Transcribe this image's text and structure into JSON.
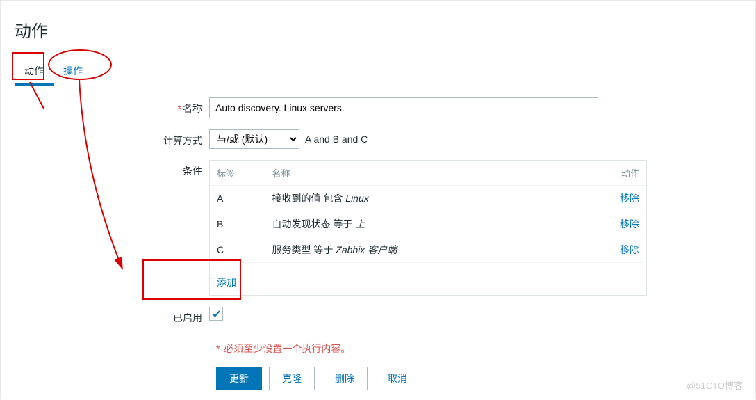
{
  "page": {
    "title": "动作"
  },
  "tabs": [
    {
      "id": "action",
      "label": "动作",
      "active": true
    },
    {
      "id": "operation",
      "label": "操作",
      "active": false
    }
  ],
  "fields": {
    "name_label": "名称",
    "name_value": "Auto discovery. Linux servers.",
    "calc_label": "计算方式",
    "calc_option": "与/或 (默认)",
    "calc_expr": "A and B and C",
    "cond_label": "条件",
    "enabled_label": "已启用",
    "required_note": "必须至少设置一个执行内容。"
  },
  "cond_headers": {
    "label": "标签",
    "name": "名称",
    "action": "动作"
  },
  "conditions": [
    {
      "tag": "A",
      "desc_prefix": "接收到的值 包含 ",
      "desc_italic": "Linux",
      "remove": "移除"
    },
    {
      "tag": "B",
      "desc_prefix": "自动发现状态 等于 ",
      "desc_italic": "上",
      "remove": "移除"
    },
    {
      "tag": "C",
      "desc_prefix": "服务类型 等于 ",
      "desc_italic": "Zabbix 客户端",
      "remove": "移除"
    }
  ],
  "add_link": "添加",
  "buttons": {
    "update": "更新",
    "clone": "克隆",
    "delete": "删除",
    "cancel": "取消"
  },
  "watermark": "@51CTO博客"
}
